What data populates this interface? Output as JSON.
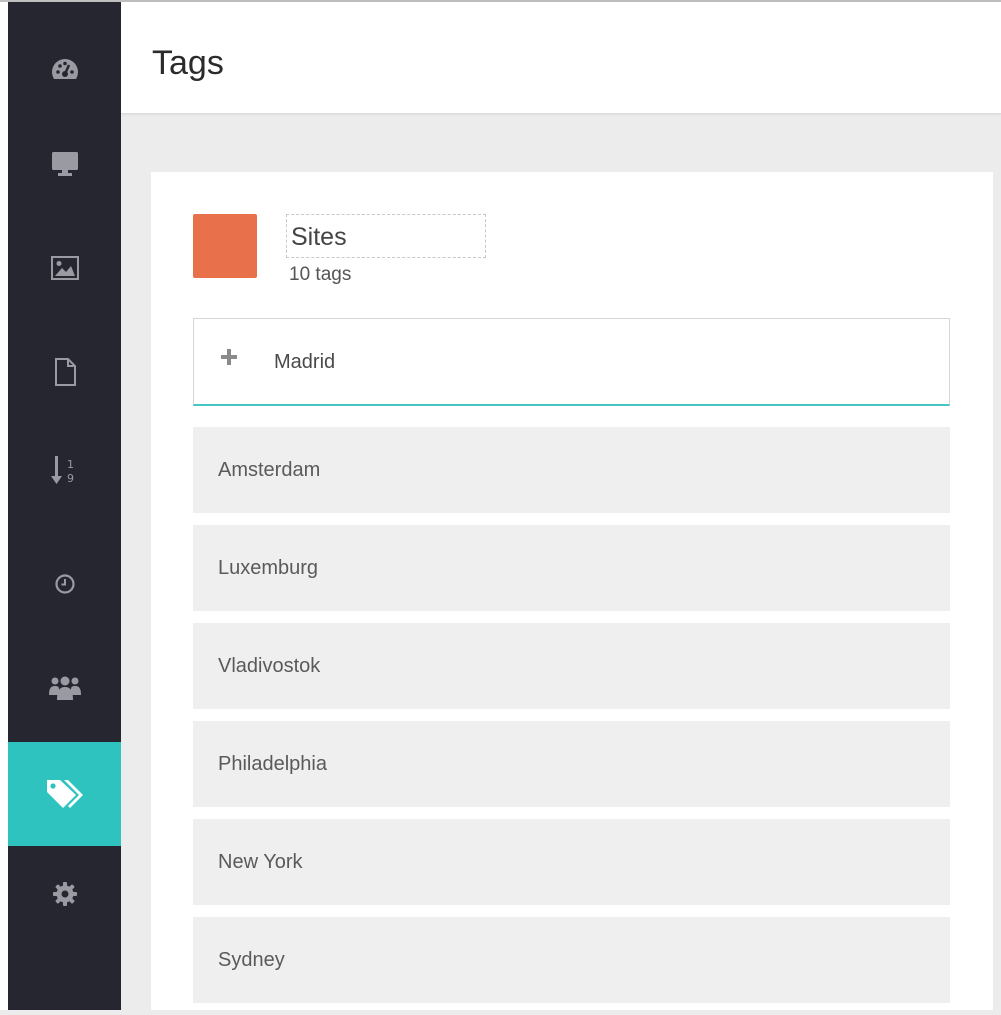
{
  "header": {
    "title": "Tags"
  },
  "sidebar": {
    "active_color": "#2fc3c0",
    "items": [
      {
        "icon": "dashboard-icon"
      },
      {
        "icon": "monitor-icon"
      },
      {
        "icon": "image-icon"
      },
      {
        "icon": "file-icon"
      },
      {
        "icon": "sort-numeric-icon"
      },
      {
        "icon": "clock-icon"
      },
      {
        "icon": "users-icon"
      },
      {
        "icon": "tags-icon",
        "active": true
      },
      {
        "icon": "gear-icon"
      }
    ]
  },
  "group": {
    "color": "#e8704b",
    "name": "Sites",
    "count_text": "10 tags"
  },
  "add_tag": {
    "value": "Madrid"
  },
  "tags": [
    "Amsterdam",
    "Luxemburg",
    "Vladivostok",
    "Philadelphia",
    "New York",
    "Sydney"
  ]
}
